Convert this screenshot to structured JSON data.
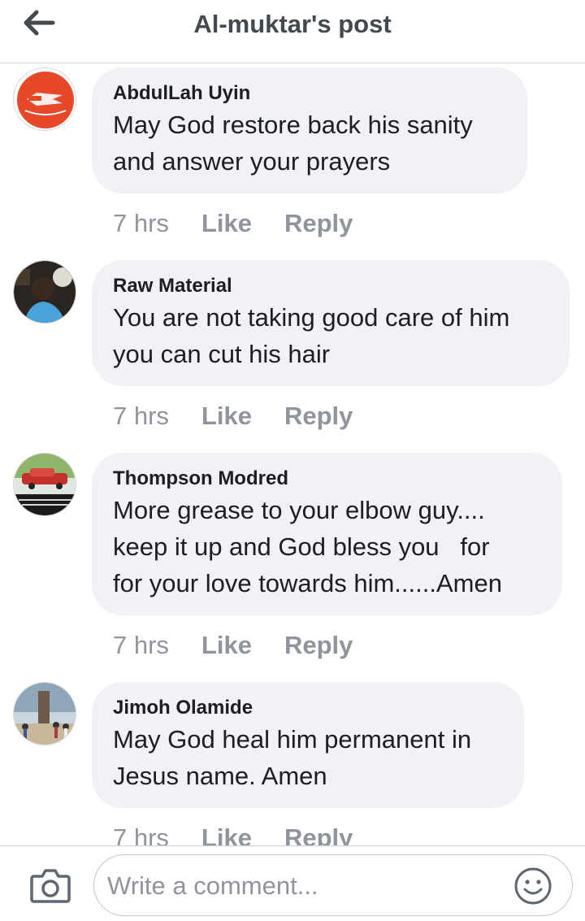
{
  "header": {
    "title": "Al-muktar's post",
    "back_icon": "arrow-left-icon"
  },
  "comments": [
    {
      "author": "AbdulLah Uyin",
      "text": "May God restore back his sanity\nand answer your prayers",
      "time": "7 hrs",
      "like": "Like",
      "reply": "Reply",
      "avatar_colors": [
        "#e8482a",
        "#ffffff"
      ]
    },
    {
      "author": "Raw Material",
      "text": "You are not taking good care of him\nyou can cut his hair",
      "time": "7 hrs",
      "like": "Like",
      "reply": "Reply",
      "avatar_colors": [
        "#2a2520",
        "#4aa3d8"
      ]
    },
    {
      "author": "Thompson Modred",
      "text": "More grease to your elbow guy....\nkeep it up and God bless you   for\nfor your love towards him......Amen",
      "time": "7 hrs",
      "like": "Like",
      "reply": "Reply",
      "avatar_colors": [
        "#c4302b",
        "#1a1a1a"
      ]
    },
    {
      "author": "Jimoh Olamide",
      "text": "May God heal him permanent in\nJesus name. Amen",
      "time": "7 hrs",
      "like": "Like",
      "reply": "Reply",
      "avatar_colors": [
        "#8fa6b8",
        "#c9b79a"
      ]
    }
  ],
  "composer": {
    "placeholder": "Write a comment...",
    "camera_icon": "camera-icon",
    "emoji_icon": "smiley-icon"
  },
  "colors": {
    "bubble": "#f0f2f5",
    "meta_text": "#90949c",
    "header_text": "#444950"
  }
}
